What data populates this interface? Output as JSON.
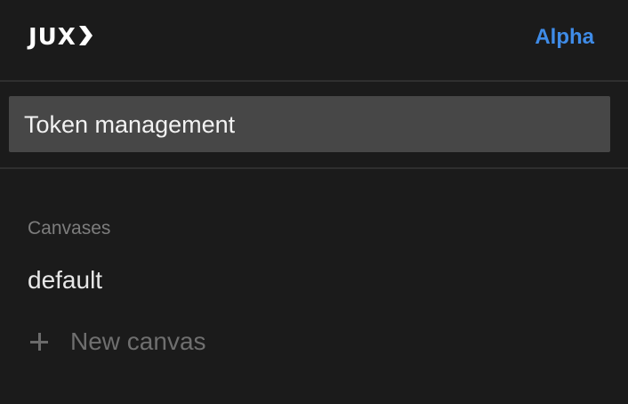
{
  "header": {
    "logo_text": "JUX",
    "logo_icon": "chevron-right-icon",
    "badge": "Alpha",
    "badge_color": "#3f8ce8"
  },
  "token_management": {
    "label": "Token management"
  },
  "canvases": {
    "section_label": "Canvases",
    "items": [
      {
        "label": "default"
      }
    ],
    "new_canvas": {
      "icon": "plus-icon",
      "label": "New canvas"
    }
  }
}
